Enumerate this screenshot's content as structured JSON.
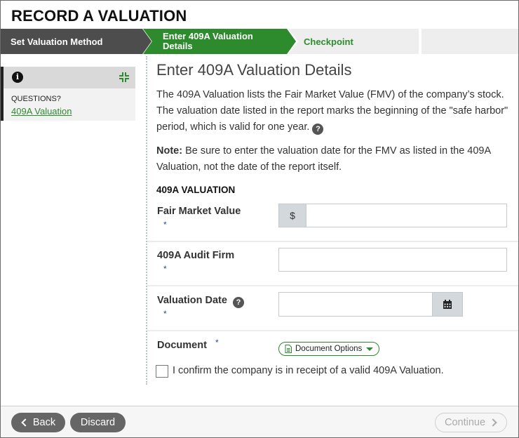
{
  "page": {
    "title": "RECORD A VALUATION"
  },
  "steps": [
    {
      "label": "Set Valuation Method",
      "state": "done"
    },
    {
      "label": "Enter 409A Valuation Details",
      "state": "current"
    },
    {
      "label": "Checkpoint",
      "state": "upcoming"
    }
  ],
  "sidebar": {
    "questions_label": "QUESTIONS?",
    "link_label": "409A Valuation",
    "info_icon": "info-icon",
    "collapse_icon": "collapse-icon"
  },
  "main": {
    "heading": "Enter 409A Valuation Details",
    "intro": "The 409A Valuation lists the Fair Market Value (FMV) of the company’s stock. The valuation date listed in the report marks the beginning of the \"safe harbor\" period, which is valid for one year.",
    "note_label": "Note:",
    "note_text": " Be sure to enter the valuation date for the FMV as listed in the 409A Valuation, not the date of the report itself.",
    "section_title": "409A VALUATION"
  },
  "form": {
    "fmv": {
      "label": "Fair Market Value",
      "required": "*",
      "prefix": "$",
      "value": ""
    },
    "audit_firm": {
      "label": "409A Audit Firm",
      "required": "*",
      "value": ""
    },
    "valuation_date": {
      "label": "Valuation Date",
      "required": "*",
      "value": ""
    },
    "document": {
      "label": "Document",
      "required": "*",
      "button_label": "Document Options"
    },
    "confirm": {
      "label": "I confirm the company is in receipt of a valid 409A Valuation.",
      "checked": false
    }
  },
  "footer": {
    "back_label": "Back",
    "discard_label": "Discard",
    "continue_label": "Continue"
  },
  "colors": {
    "accent_green": "#2d8a2d",
    "step_done": "#4d4d4d",
    "required_blue": "#1f4e8c",
    "button_gray": "#666666"
  }
}
